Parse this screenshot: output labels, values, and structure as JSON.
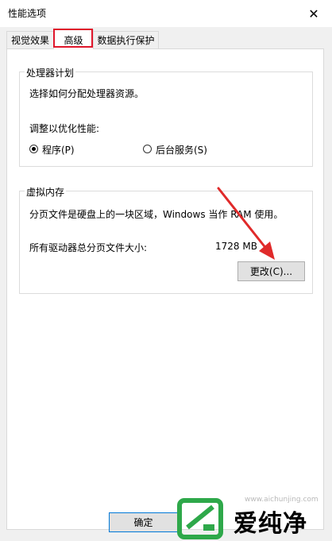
{
  "window": {
    "title": "性能选项",
    "close_glyph": "✕"
  },
  "tabs": [
    {
      "label": "视觉效果",
      "active": false
    },
    {
      "label": "高级",
      "active": true
    },
    {
      "label": "数据执行保护",
      "active": false
    }
  ],
  "processor": {
    "group_title": "处理器计划",
    "description": "选择如何分配处理器资源。",
    "adjust_label": "调整以优化性能:",
    "options": [
      {
        "label": "程序(P)",
        "checked": true
      },
      {
        "label": "后台服务(S)",
        "checked": false
      }
    ]
  },
  "memory": {
    "group_title": "虚拟内存",
    "description": "分页文件是硬盘上的一块区域，Windows 当作 RAM 使用。",
    "total_label": "所有驱动器总分页文件大小:",
    "total_value": "1728 MB",
    "change_button": "更改(C)..."
  },
  "footer": {
    "ok_button": "确定"
  },
  "watermark": {
    "logo_text": "爱纯净",
    "url": "www.aichunjing.com",
    "arrow_color": "#e02a2a",
    "logo_color": "#2ea84a"
  },
  "colors": {
    "highlight_border": "#e0162b",
    "button_bg": "#e1e1e1",
    "button_focus": "#0078d7"
  }
}
